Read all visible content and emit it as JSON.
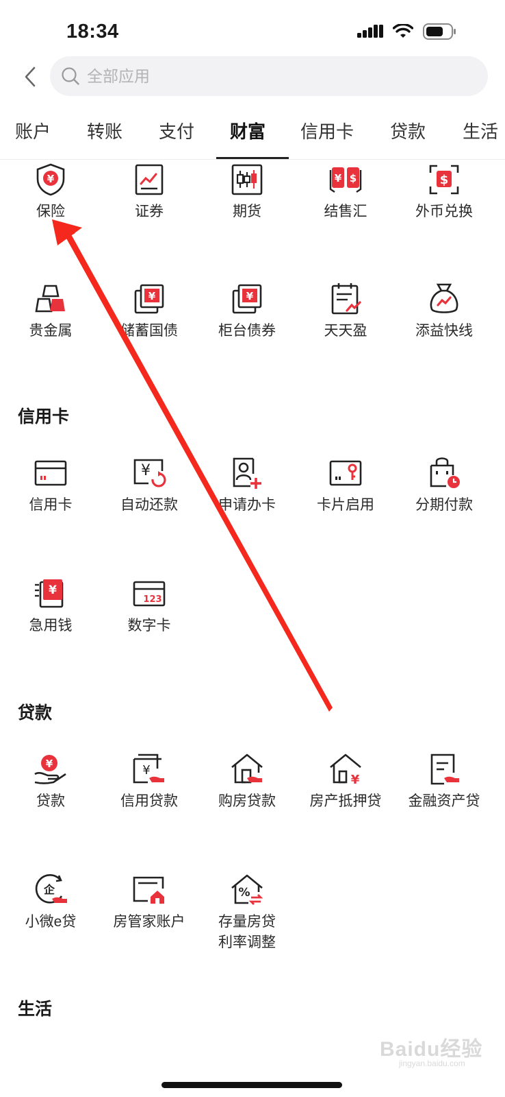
{
  "status_bar": {
    "time": "18:34"
  },
  "search": {
    "placeholder": "全部应用"
  },
  "tabs": [
    {
      "label": "账户"
    },
    {
      "label": "转账"
    },
    {
      "label": "支付"
    },
    {
      "label": "财富"
    },
    {
      "label": "信用卡"
    },
    {
      "label": "贷款"
    },
    {
      "label": "生活"
    }
  ],
  "active_tab": "财富",
  "wealth_items": [
    {
      "label": "保险",
      "icon": "shield-yuan-icon"
    },
    {
      "label": "证券",
      "icon": "stock-chart-icon"
    },
    {
      "label": "期货",
      "icon": "candlestick-icon"
    },
    {
      "label": "结售汇",
      "icon": "currency-exchange-icon"
    },
    {
      "label": "外币兑换",
      "icon": "dollar-scan-icon"
    },
    {
      "label": "贵金属",
      "icon": "gold-bars-icon"
    },
    {
      "label": "储蓄国债",
      "icon": "stacked-yuan-icon"
    },
    {
      "label": "柜台债券",
      "icon": "stacked-yuan-icon"
    },
    {
      "label": "天天盈",
      "icon": "calendar-trend-icon"
    },
    {
      "label": "添益快线",
      "icon": "money-bag-icon"
    }
  ],
  "credit_card_section": {
    "title": "信用卡",
    "items": [
      {
        "label": "信用卡",
        "icon": "credit-card-icon"
      },
      {
        "label": "自动还款",
        "icon": "auto-repay-icon"
      },
      {
        "label": "申请办卡",
        "icon": "apply-card-icon"
      },
      {
        "label": "卡片启用",
        "icon": "card-key-icon"
      },
      {
        "label": "分期付款",
        "icon": "installment-bag-icon"
      },
      {
        "label": "急用钱",
        "icon": "emergency-money-icon"
      },
      {
        "label": "数字卡",
        "icon": "digital-card-icon"
      }
    ]
  },
  "loan_section": {
    "title": "贷款",
    "items": [
      {
        "label": "贷款",
        "icon": "hand-yuan-icon"
      },
      {
        "label": "信用贷款",
        "icon": "credit-loan-icon"
      },
      {
        "label": "购房贷款",
        "icon": "house-loan-icon"
      },
      {
        "label": "房产抵押贷",
        "icon": "house-mortgage-icon"
      },
      {
        "label": "金融资产贷",
        "icon": "document-loan-icon"
      },
      {
        "label": "小微e贷",
        "icon": "enterprise-loan-icon"
      },
      {
        "label": "房管家账户",
        "icon": "house-account-icon"
      },
      {
        "label": "存量房贷利率调整",
        "icon": "house-percent-icon",
        "label_line1": "存量房贷",
        "label_line2": "利率调整"
      }
    ]
  },
  "life_section": {
    "title": "生活"
  },
  "watermark": {
    "text": "Baidu经验",
    "sub": "jingyan.baidu.com"
  },
  "colors": {
    "accent_red": "#e8323c",
    "arrow_red": "#f5281e",
    "icon_stroke": "#222222"
  }
}
